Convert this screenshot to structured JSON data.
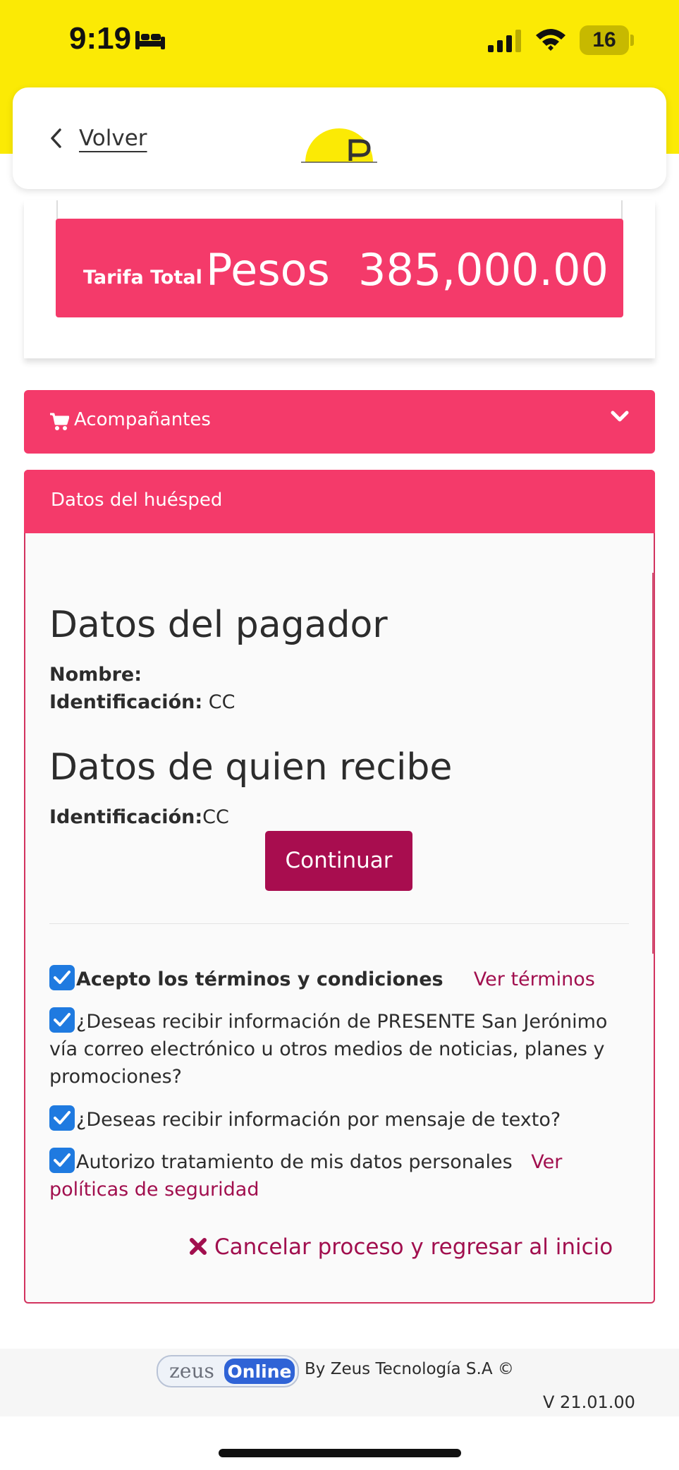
{
  "status_bar": {
    "time": "9:19",
    "battery": "16",
    "icons": [
      "bed-icon",
      "signal-icon",
      "wifi-icon"
    ]
  },
  "header": {
    "back_label": "Volver",
    "logo_letter": "P"
  },
  "tarifa": {
    "label": "Tarifa Total",
    "currency": "Pesos",
    "amount": "385,000.00"
  },
  "accordion": {
    "acompanantes_label": "Acompañantes"
  },
  "guest": {
    "header_label": "Datos del huésped",
    "payer_title": "Datos del pagador",
    "payer_name_label": "Nombre:",
    "payer_id_label": "Identificación:",
    "payer_id_value": " CC",
    "receiver_title": "Datos de quien recibe",
    "receiver_id_label": "Identificación:",
    "receiver_id_value": "CC",
    "continue_label": "Continuar"
  },
  "consents": {
    "terms_label": "Acepto los términos y condiciones",
    "terms_link": "Ver términos",
    "email_label": "¿Deseas recibir información de PRESENTE San Jerónimo vía correo electrónico u otros medios de noticias, planes y promociones?",
    "sms_label": "¿Deseas recibir información por mensaje de texto?",
    "data_label": "Autorizo tratamiento de mis datos personales",
    "data_link": "Ver políticas de seguridad",
    "cancel_label": "Cancelar proceso y regresar al inicio"
  },
  "footer": {
    "logo_word_1": "zeus",
    "logo_word_2": "Online",
    "credit": "By Zeus Tecnología S.A ©",
    "version": "V 21.01.00"
  },
  "colors": {
    "status_yellow": "#fbea05",
    "accent_pink": "#f43a6a",
    "button_maroon": "#a80d4f",
    "link_maroon": "#a10f4e",
    "checkbox_blue": "#1f7ae0"
  }
}
